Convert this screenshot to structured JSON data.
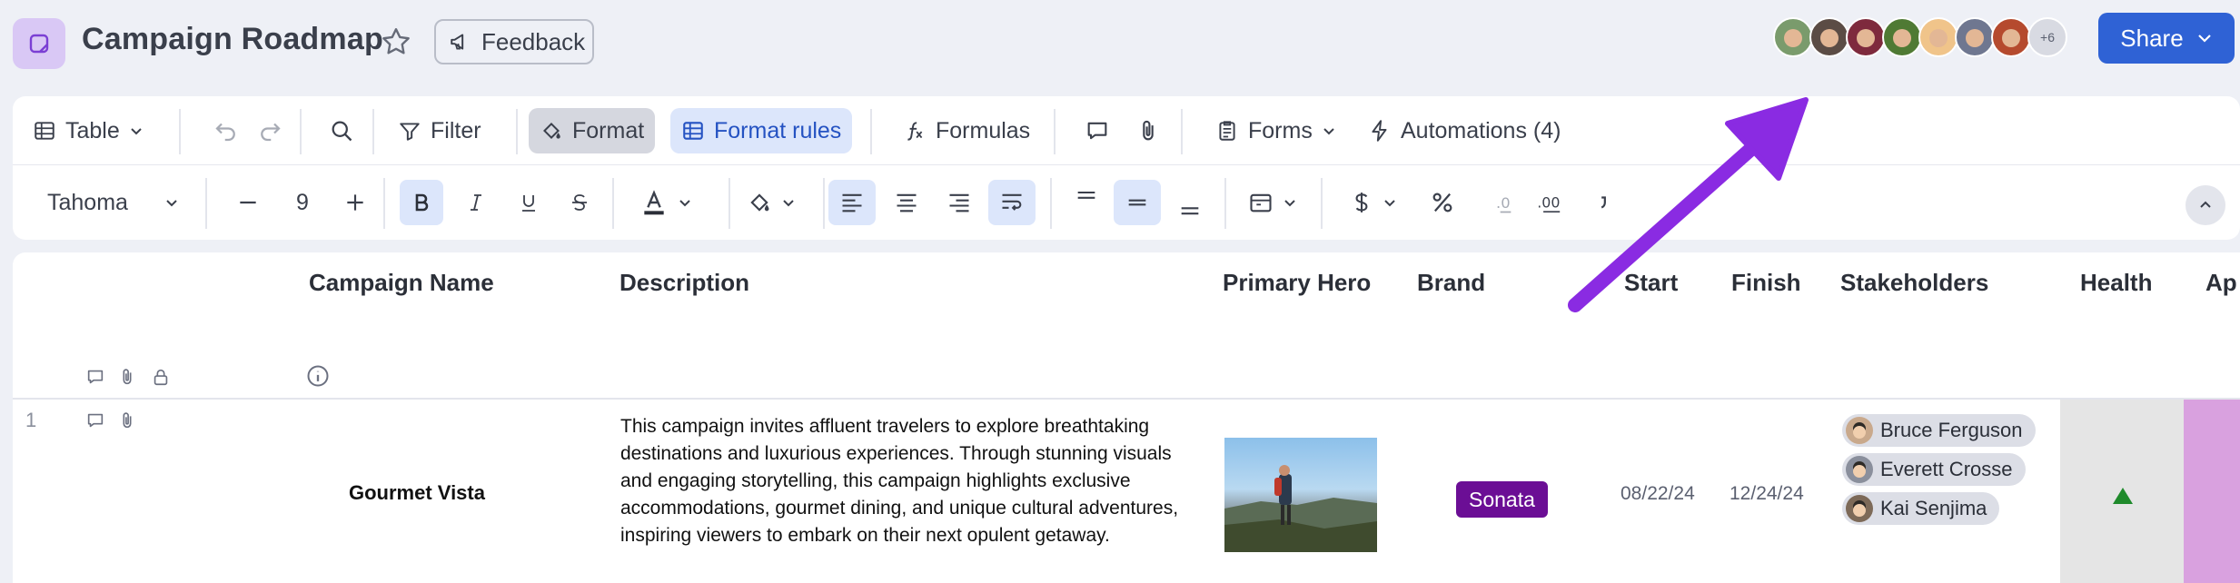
{
  "header": {
    "title": "Campaign Roadmap",
    "feedback_label": "Feedback",
    "share_label": "Share",
    "collaborators_more": "+6",
    "collaborator_colors": [
      "#7a9b6c",
      "#5b4c45",
      "#7e2a3d",
      "#4f7a34",
      "#f0c48a",
      "#6f7790",
      "#b54a2e"
    ]
  },
  "toolbar": {
    "view_label": "Table",
    "filter_label": "Filter",
    "format_label": "Format",
    "format_rules_label": "Format rules",
    "formulas_label": "Formulas",
    "forms_label": "Forms",
    "automations_label": "Automations (4)",
    "font_name": "Tahoma",
    "font_size": "9"
  },
  "columns": {
    "campaign_name": "Campaign Name",
    "description": "Description",
    "primary_hero": "Primary Hero",
    "brand": "Brand",
    "start": "Start",
    "finish": "Finish",
    "stakeholders": "Stakeholders",
    "health": "Health",
    "approval": "Ap"
  },
  "rows": [
    {
      "number": "1",
      "campaign_name": "Gourmet Vista",
      "description": "This campaign invites affluent travelers to explore breathtaking destinations and luxurious experiences. Through stunning visuals and engaging storytelling, this campaign highlights exclusive accommodations, gourmet dining, and unique cultural adventures, inspiring viewers to embark on their next opulent getaway.",
      "brand": "Sonata",
      "brand_color": "#6b0e95",
      "start": "08/22/24",
      "finish": "12/24/24",
      "stakeholders": [
        "Bruce Ferguson",
        "Everett Crosse",
        "Kai Senjima"
      ],
      "health": "green-up-triangle"
    }
  ],
  "annotation": {
    "color": "#8a2be2"
  }
}
